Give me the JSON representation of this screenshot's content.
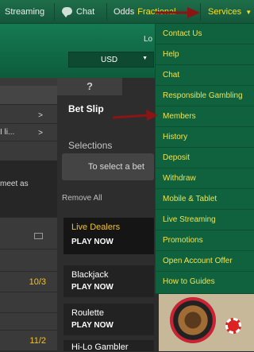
{
  "topbar": {
    "streaming_label": "Streaming",
    "chat_label": "Chat",
    "odds_label": "Odds",
    "odds_value": "Fractional",
    "services_label": "Services"
  },
  "header": {
    "login_label": "Lo",
    "currency_value": "USD"
  },
  "left": {
    "row2_text": "I li...",
    "row3_text": "meet as",
    "odds1": "10/3",
    "odds2": "11/2"
  },
  "betslip": {
    "help_tab_label": "?",
    "title": "Bet Slip",
    "selections_label": "Selections",
    "select_prompt": "To select a bet",
    "remove_all_label": "Remove All"
  },
  "promos": [
    {
      "title": "Live Dealers",
      "cta": "PLAY NOW"
    },
    {
      "title": "Blackjack",
      "cta": "PLAY NOW"
    },
    {
      "title": "Roulette",
      "cta": "PLAY NOW"
    },
    {
      "title": "Hi-Lo Gambler",
      "cta": ""
    }
  ],
  "services_menu": [
    "Contact Us",
    "Help",
    "Chat",
    "Responsible Gambling",
    "Members",
    "History",
    "Deposit",
    "Withdraw",
    "Mobile & Tablet",
    "Live Streaming",
    "Promotions",
    "Open Account Offer",
    "How to Guides"
  ],
  "colors": {
    "accent": "#ffdf1b",
    "menu_bg": "#10623f",
    "annotation_arrow": "#8b1414"
  }
}
